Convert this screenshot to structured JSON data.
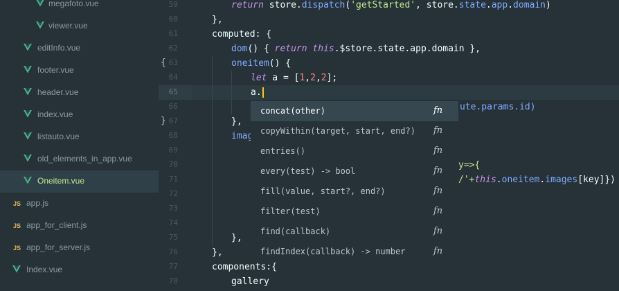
{
  "sidebar": {
    "items": [
      {
        "label": "megafoto.vue",
        "icon": "vue-icon",
        "indent": 2
      },
      {
        "label": "viewer.vue",
        "icon": "vue-icon",
        "indent": 2
      },
      {
        "label": "editInfo.vue",
        "icon": "vue-icon",
        "indent": 1
      },
      {
        "label": "footer.vue",
        "icon": "vue-icon",
        "indent": 1
      },
      {
        "label": "header.vue",
        "icon": "vue-icon",
        "indent": 1
      },
      {
        "label": "index.vue",
        "icon": "vue-icon",
        "indent": 1
      },
      {
        "label": "listauto.vue",
        "icon": "vue-icon",
        "indent": 1
      },
      {
        "label": "old_elements_in_app.vue",
        "icon": "vue-icon",
        "indent": 1
      },
      {
        "label": "Oneitem.vue",
        "icon": "vue-icon",
        "indent": 1,
        "selected": true
      },
      {
        "label": "app.js",
        "icon": "js-icon",
        "icon_text": "JS",
        "indent": 0
      },
      {
        "label": "app_for_client.js",
        "icon": "js-icon",
        "icon_text": "JS",
        "indent": 0
      },
      {
        "label": "app_for_server.js",
        "icon": "js-icon",
        "icon_text": "JS",
        "indent": 0
      },
      {
        "label": "Index.vue",
        "icon": "vue-icon",
        "indent": 0
      }
    ]
  },
  "gutter": {
    "line_numbers": [
      "59",
      "60",
      "61",
      "62",
      "63",
      "64",
      "65",
      "66",
      "67",
      "68",
      "69",
      "70",
      "71",
      "72",
      "73",
      "74",
      "75",
      "76",
      "77",
      "78"
    ],
    "current_line": "65",
    "fold_markers": [
      "{",
      "}"
    ]
  },
  "editor": {
    "line_59": {
      "kw": "return",
      "t1": " store.",
      "fn": "dispatch",
      "t2": "(",
      "str": "'getStarted'",
      "t3": ", store.",
      "fn2": "state",
      "t4": ".",
      "fn3": "app",
      "t5": ".",
      "fn4": "domain",
      "t6": ")"
    },
    "line_60": "},",
    "line_61": "computed: {",
    "line_62": {
      "fn": "dom",
      "t1": "() { ",
      "kw": "return",
      "sp": " ",
      "kw2": "this",
      "t2": ".$store.state.app.domain }",
      "t3": ","
    },
    "line_63": {
      "fn": "oneitem",
      "t1": "() {"
    },
    "line_64": {
      "kw": "let",
      "t1": " a = [",
      "n1": "1",
      "c1": ",",
      "n2": "2",
      "c2": ",",
      "n3": "2",
      "t2": "];"
    },
    "line_65": "a.",
    "line_66_tail": "ute.params.id)",
    "line_67": "},",
    "line_68": "imag",
    "line_70_tail": "y=>{",
    "line_71_tail": {
      "t1": "/'+",
      "kw": "this",
      "t2": ".",
      "fn": "oneitem",
      "t3": ".",
      "fn2": "images",
      "t4": "[key]})"
    },
    "line_75": "},",
    "line_76": "},",
    "line_77": "components:{",
    "line_78": "gallery"
  },
  "autocomplete": {
    "items": [
      {
        "text": "concat(other)",
        "type": "fn",
        "selected": true
      },
      {
        "text": "copyWithin(target, start, end?)",
        "type": "fn"
      },
      {
        "text": "entries()",
        "type": "fn"
      },
      {
        "text": "every(test) -> bool",
        "type": "fn"
      },
      {
        "text": "fill(value, start?, end?)",
        "type": "fn"
      },
      {
        "text": "filter(test)",
        "type": "fn"
      },
      {
        "text": "find(callback)",
        "type": "fn"
      },
      {
        "text": "findIndex(callback) -> number",
        "type": "fn"
      }
    ]
  },
  "colors": {
    "background": "#263238",
    "keyword": "#c792ea",
    "function": "#82aaff",
    "string": "#c3e88d",
    "number": "#f78c6c",
    "vue_icon": "#41b883",
    "js_icon": "#e6b45a",
    "cursor": "#ffcc00"
  }
}
